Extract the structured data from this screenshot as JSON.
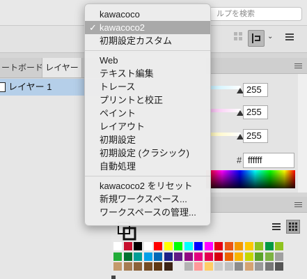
{
  "search": {
    "placeholder": "ルプを検索"
  },
  "panels": {
    "tabs": [
      {
        "label": "ートボード"
      },
      {
        "label": "レイヤー"
      }
    ],
    "layers": [
      {
        "name": "レイヤー 1"
      }
    ]
  },
  "color_panel": {
    "values": [
      "255",
      "255",
      "255"
    ],
    "hash": "#",
    "hex": "ffffff"
  },
  "menu": {
    "workspaces": [
      "kawacoco",
      "kawacoco2",
      "初期設定カスタム"
    ],
    "presets": [
      "Web",
      "テキスト編集",
      "トレース",
      "プリントと校正",
      "ペイント",
      "レイアウト",
      "初期設定",
      "初期設定 (クラシック)",
      "自動処理"
    ],
    "actions": [
      "kawacoco2 をリセット",
      "新規ワークスペース...",
      "ワークスペースの管理..."
    ],
    "selected_index": 1,
    "checkmark": "✓"
  },
  "swatch_colors": {
    "row1": [
      "#ffffff",
      "#c8102e",
      "#000000",
      "#ffffff",
      "#ff0000",
      "#ffff00",
      "#00ff00",
      "#00ffff",
      "#0000ff",
      "#ff00ff",
      "#e60012",
      "#ea5514",
      "#f39800",
      "#fcc800",
      "#8fc31f",
      "#009944",
      "#8fc31f"
    ],
    "row2": [
      "#22ac38",
      "#007130",
      "#009e96",
      "#00a0e9",
      "#0068b7",
      "#1d2088",
      "#601986",
      "#920783",
      "#e4007f",
      "#e5004f",
      "#d7000f",
      "#eb6100",
      "#f8b500",
      "#c3d600",
      "#5aa32a",
      "#7cb342",
      "#a0a0a0"
    ],
    "row3": [
      "#c49a6c",
      "#a67c52",
      "#8c6239",
      "#754c24",
      "#603813",
      "#3c2415",
      "#eaeaea",
      "#b3b3b3",
      "#ff9999",
      "#ffcc66",
      "#cccccc",
      "#c0c0c0",
      "#8c8c8c",
      "#d4a373",
      "#999999",
      "#777777",
      "#555555"
    ]
  }
}
